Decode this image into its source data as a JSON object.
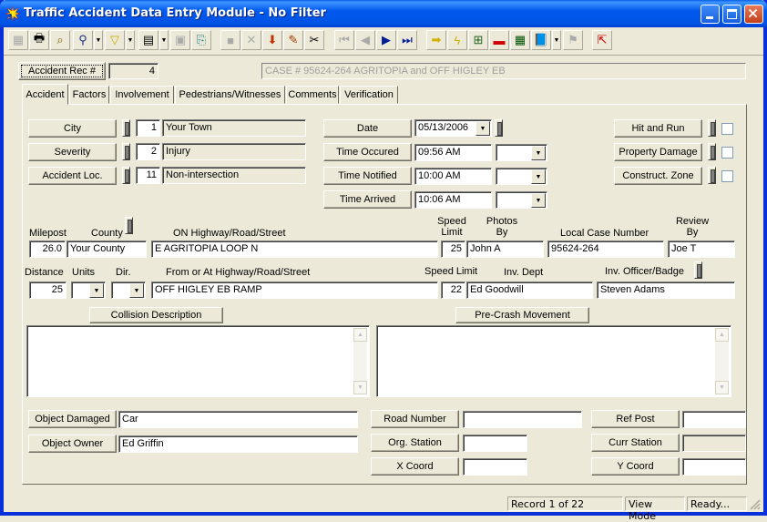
{
  "window": {
    "title": "Traffic Accident Data Entry Module - No Filter",
    "controls": [
      "minimize",
      "maximize",
      "close"
    ]
  },
  "toolbar": {
    "buttons": [
      {
        "icon": "form-view-icon",
        "enabled": false
      },
      {
        "icon": "print-icon",
        "enabled": true
      },
      {
        "icon": "print-preview-icon",
        "enabled": true
      },
      {
        "icon": "find-icon",
        "enabled": true,
        "dropdown": true
      },
      {
        "icon": "filter-icon",
        "enabled": true,
        "dropdown": true
      },
      {
        "icon": "report-icon",
        "enabled": true,
        "dropdown": true
      },
      {
        "icon": "properties-icon",
        "enabled": false
      },
      {
        "icon": "export-icon",
        "enabled": true
      },
      {
        "icon": "save-icon",
        "enabled": false
      },
      {
        "icon": "delete-icon",
        "enabled": false
      },
      {
        "icon": "add-record-icon",
        "enabled": true
      },
      {
        "icon": "edit-icon",
        "enabled": true
      },
      {
        "icon": "cut-icon",
        "enabled": true
      },
      {
        "icon": "first-record-icon",
        "enabled": false
      },
      {
        "icon": "previous-record-icon",
        "enabled": false
      },
      {
        "icon": "next-record-icon",
        "enabled": true
      },
      {
        "icon": "last-record-icon",
        "enabled": true
      },
      {
        "icon": "goto-icon",
        "enabled": true
      },
      {
        "icon": "quick-icon",
        "enabled": true
      },
      {
        "icon": "diagram-icon",
        "enabled": true
      },
      {
        "icon": "toolbox-icon",
        "enabled": true
      },
      {
        "icon": "calculator-icon",
        "enabled": true
      },
      {
        "icon": "help-book-icon",
        "enabled": true,
        "dropdown": true
      },
      {
        "icon": "flag-icon",
        "enabled": false
      },
      {
        "icon": "exit-icon",
        "enabled": true
      }
    ]
  },
  "header": {
    "rec_button": "Accident Rec #",
    "rec_value": "4",
    "case_summary": "CASE # 95624-264  AGRITOPIA and OFF HIGLEY EB"
  },
  "tabs": [
    {
      "label": "Accident",
      "active": true
    },
    {
      "label": "Factors",
      "active": false
    },
    {
      "label": "Involvement",
      "active": false
    },
    {
      "label": "Pedestrians/Witnesses",
      "active": false
    },
    {
      "label": "Comments",
      "active": false
    },
    {
      "label": "Verification",
      "active": false
    }
  ],
  "lookups": [
    {
      "label": "City",
      "code": "1",
      "value": "Your Town"
    },
    {
      "label": "Severity",
      "code": "2",
      "value": "Injury"
    },
    {
      "label": "Accident Loc.",
      "code": "11",
      "value": "Non-intersection"
    }
  ],
  "times": {
    "date_label": "Date",
    "date_value": "05/13/2006",
    "rows": [
      {
        "label": "Time Occured",
        "value": "09:56 AM",
        "extra": ""
      },
      {
        "label": "Time Notified",
        "value": "10:00 AM",
        "extra": ""
      },
      {
        "label": "Time Arrived",
        "value": "10:06 AM",
        "extra": ""
      }
    ]
  },
  "flags": [
    {
      "label": "Hit and Run",
      "checked": false
    },
    {
      "label": "Property Damage",
      "checked": false
    },
    {
      "label": "Construct. Zone",
      "checked": false
    }
  ],
  "location": {
    "milepost_label": "Milepost",
    "milepost": "26.0",
    "county_label": "County",
    "county": "Your County",
    "on_road_label": "ON Highway/Road/Street",
    "on_road": "E AGRITOPIA LOOP N",
    "speed_limit_label_1": "Speed",
    "speed_limit_label_2": "Limit",
    "speed_limit": "25",
    "photos_label_1": "Photos",
    "photos_label_2": "By",
    "photos_by": "John A",
    "local_case_label": "Local Case Number",
    "local_case": "95624-264",
    "review_label_1": "Review",
    "review_label_2": "By",
    "review_by": "Joe T",
    "distance_label": "Distance",
    "distance": "25",
    "units_label": "Units",
    "units": "",
    "dir_label": "Dir.",
    "dir": "",
    "from_road_label": "From or At Highway/Road/Street",
    "from_road": "OFF HIGLEY EB RAMP",
    "speed_limit2_label": "Speed Limit",
    "speed_limit2": "22",
    "inv_dept_label": "Inv. Dept",
    "inv_dept": "Ed Goodwill",
    "inv_officer_label": "Inv. Officer/Badge",
    "inv_officer": "Steven Adams"
  },
  "descriptions": {
    "collision_button": "Collision Description",
    "collision_text": "",
    "precrash_button": "Pre-Crash Movement",
    "precrash_text": ""
  },
  "objects": {
    "damaged_button": "Object Damaged",
    "damaged": "Car",
    "owner_button": "Object Owner",
    "owner": "Ed Griffin"
  },
  "road": {
    "road_number_button": "Road Number",
    "road_number": "",
    "org_station_button": "Org. Station",
    "org_station": "",
    "x_coord_button": "X Coord",
    "x_coord": "",
    "ref_post_button": "Ref Post",
    "ref_post": "",
    "curr_station_button": "Curr Station",
    "curr_station": "",
    "y_coord_button": "Y Coord",
    "y_coord": ""
  },
  "status": {
    "record": "Record 1 of 22",
    "mode": "View Mode",
    "state": "Ready..."
  }
}
